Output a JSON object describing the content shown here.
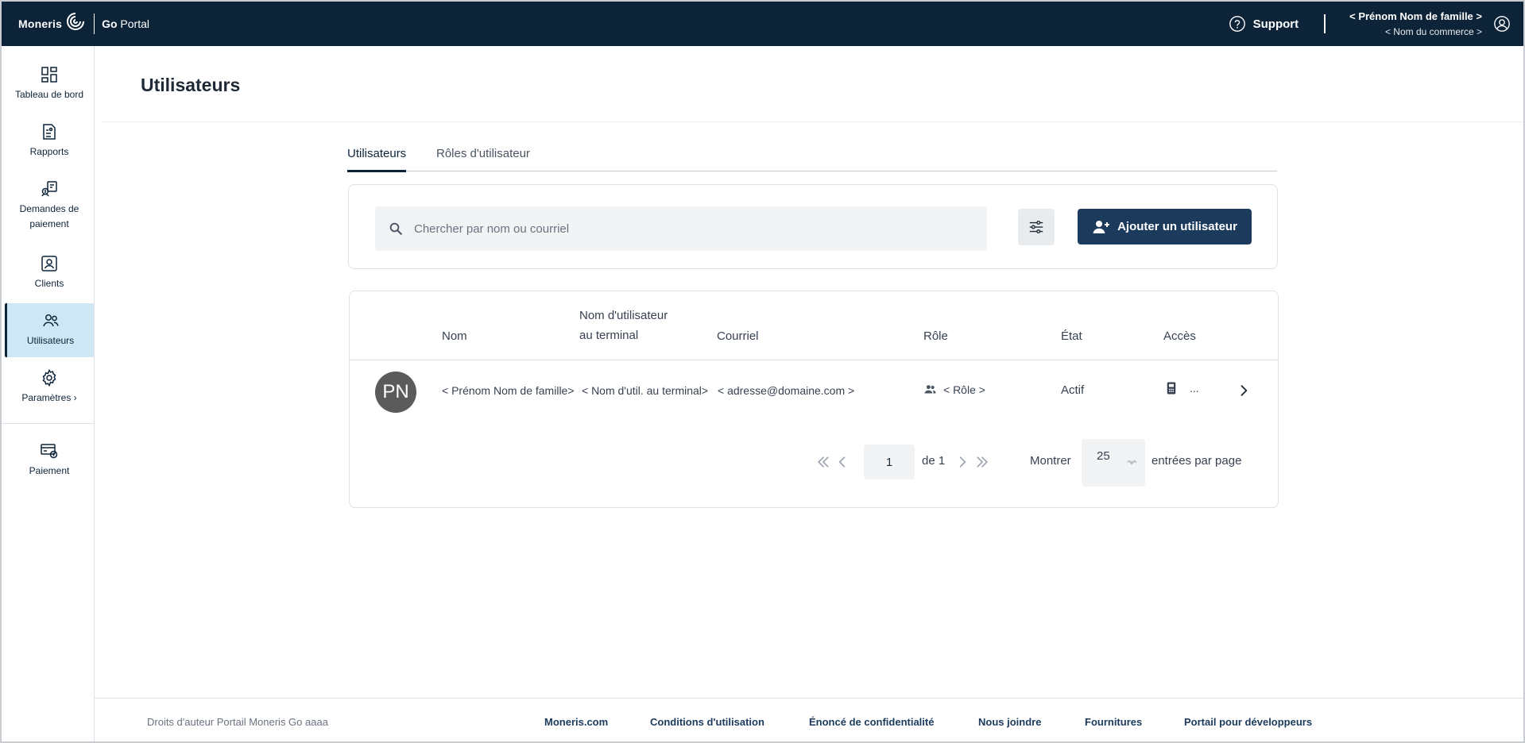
{
  "header": {
    "brand_name": "Moneris",
    "product_prefix": "Go",
    "product_name": " Portal",
    "support_label": "Support",
    "user_name": "< Prénom Nom de famille >",
    "merchant_name": "< Nom du commerce >"
  },
  "sidebar": {
    "items": [
      {
        "label": "Tableau de bord",
        "icon": "dashboard-icon"
      },
      {
        "label": "Rapports",
        "icon": "reports-icon"
      },
      {
        "label": "Demandes de paiement",
        "icon": "payment-request-icon"
      },
      {
        "label": "Clients",
        "icon": "clients-icon"
      },
      {
        "label": "Utilisateurs",
        "icon": "users-icon",
        "active": true
      },
      {
        "label": "Paramètres ›",
        "icon": "settings-icon"
      },
      {
        "label": "Paiement",
        "icon": "payment-icon"
      }
    ]
  },
  "page": {
    "title": "Utilisateurs"
  },
  "tabs": [
    {
      "label": "Utilisateurs",
      "active": true
    },
    {
      "label": "Rôles d'utilisateur",
      "active": false
    }
  ],
  "search": {
    "placeholder": "Chercher par nom ou courriel",
    "value": ""
  },
  "toolbar": {
    "add_user_label": "Ajouter un utilisateur"
  },
  "table": {
    "headers": {
      "name": "Nom",
      "terminal_user_line1": "Nom d'utilisateur",
      "terminal_user_line2": "au terminal",
      "email": "Courriel",
      "role": "Rôle",
      "state": "État",
      "access": "Accès"
    },
    "rows": [
      {
        "initials": "PN",
        "name": "< Prénom Nom de famille>",
        "terminal_user": "< Nom d'util. au terminal>",
        "email": "< adresse@domaine.com >",
        "role": "< Rôle >",
        "state": "Actif",
        "access_more": "..."
      }
    ]
  },
  "pagination": {
    "current_page": "1",
    "of_label": "de 1",
    "show_label": "Montrer",
    "per_page": "25",
    "entries_label": "entrées par page"
  },
  "footer": {
    "copyright": "Droits d'auteur Portail Moneris Go  aaaa",
    "links": [
      "Moneris.com",
      "Conditions d'utilisation",
      "Énoncé de confidentialité",
      "Nous joindre",
      "Fournitures",
      "Portail pour développeurs"
    ]
  },
  "colors": {
    "header_bg": "#0d2338",
    "primary_button": "#1b3a5c",
    "active_nav_bg": "#cde7f5",
    "input_bg": "#f1f3f5"
  }
}
